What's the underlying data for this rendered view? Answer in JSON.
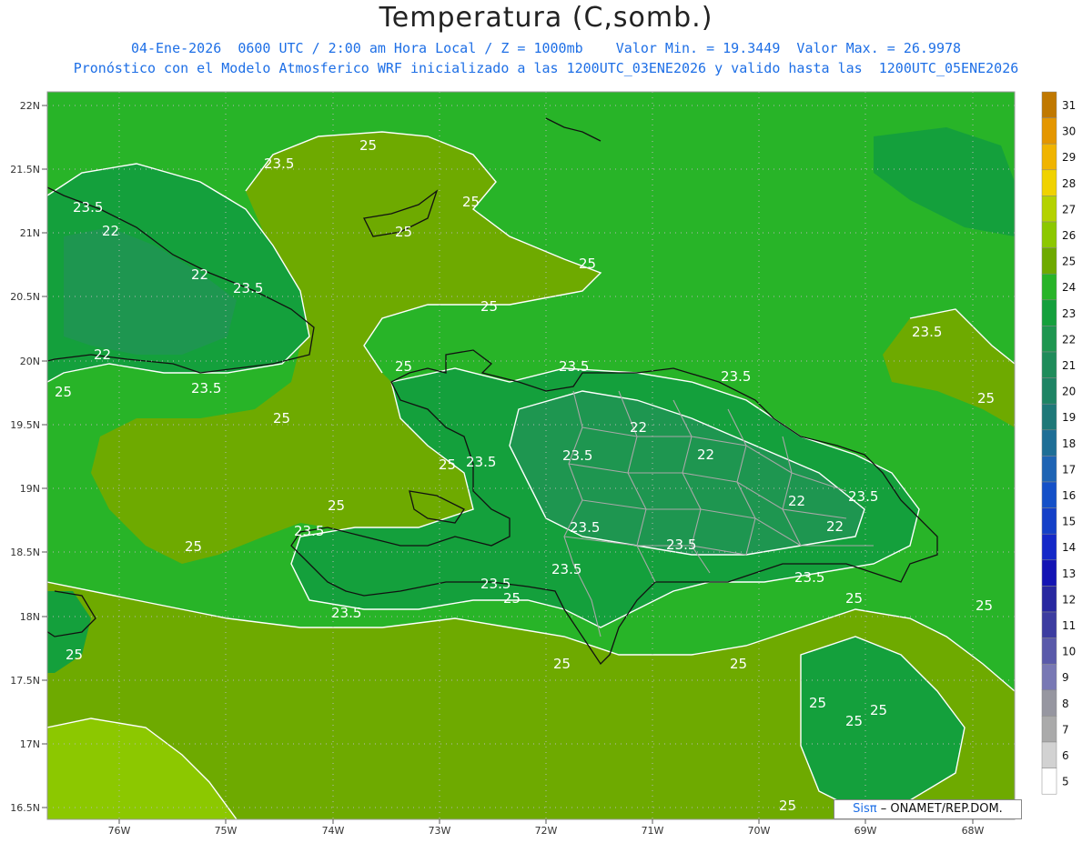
{
  "header": {
    "title": "Temperatura (C,somb.)",
    "subtitle_line1": "04-Ene-2026  0600 UTC / 2:00 am Hora Local / Z = 1000mb    Valor Min. = 19.3449  Valor Max. = 26.9978",
    "subtitle_line2": "Pronóstico con el Modelo Atmosferico WRF inicializado a las 1200UTC_03ENE2026 y valido hasta las  1200UTC_05ENE2026"
  },
  "axes": {
    "lat_labels": [
      "22N",
      "21.5N",
      "21N",
      "20.5N",
      "20N",
      "19.5N",
      "19N",
      "18.5N",
      "18N",
      "17.5N",
      "17N",
      "16.5N"
    ],
    "lon_labels": [
      "76W",
      "75W",
      "74W",
      "73W",
      "72W",
      "71W",
      "70W",
      "69W",
      "68W"
    ]
  },
  "colorbar": {
    "labels": [
      "31",
      "30",
      "29",
      "28",
      "27",
      "26",
      "25",
      "24",
      "23",
      "22",
      "21",
      "20",
      "19",
      "18",
      "17",
      "16",
      "15",
      "14",
      "13",
      "12",
      "11",
      "10",
      "9",
      "8",
      "7",
      "6",
      "5"
    ],
    "colors": [
      "#c07800",
      "#e49600",
      "#f0b400",
      "#f0d200",
      "#b4d200",
      "#8cc800",
      "#6eaa00",
      "#28b428",
      "#14a03c",
      "#1e9650",
      "#1e8c5a",
      "#1e8464",
      "#1e7878",
      "#1e6e96",
      "#1e64b4",
      "#1450c8",
      "#1440c8",
      "#1428c8",
      "#1414b4",
      "#2828a0",
      "#3c3ca0",
      "#5a5aaa",
      "#7878b4",
      "#9696a0",
      "#aaaaaa",
      "#d2d2d2",
      "#ffffff"
    ]
  },
  "contour_labels": {
    "l25": "25",
    "l235": "23.5",
    "l22": "22"
  },
  "credit": {
    "brand": "Sisπ",
    "org": "– ONAMET/REP.DOM."
  }
}
